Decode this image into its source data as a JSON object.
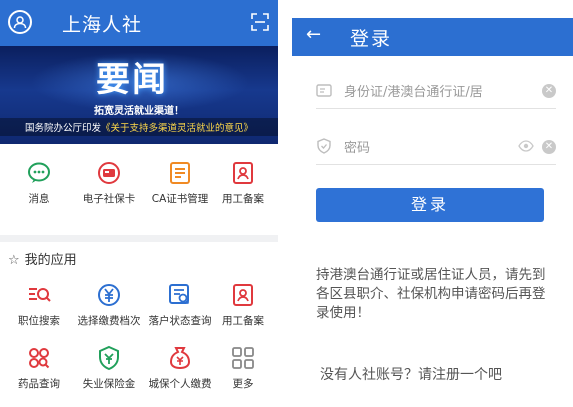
{
  "left": {
    "app_title": "上海人社",
    "banner": {
      "headline": "要闻",
      "sub1": "拓宽灵活就业渠道！",
      "sub2_prefix": "国务院办公厅印发",
      "sub2_highlight": "《关于支持多渠道灵活就业的意见》"
    },
    "top_grid": [
      {
        "label": "消息",
        "icon": "message-icon",
        "color": "#21a05b"
      },
      {
        "label": "电子社保卡",
        "icon": "social-security-card-icon",
        "color": "#e0393e"
      },
      {
        "label": "CA证书管理",
        "icon": "ca-certificate-icon",
        "color": "#f08a24"
      },
      {
        "label": "用工备案",
        "icon": "employment-record-icon",
        "color": "#e0393e"
      }
    ],
    "my_apps_title": "我的应用",
    "apps": [
      {
        "label": "职位搜索",
        "icon": "job-search-icon",
        "color": "#e0393e"
      },
      {
        "label": "选择缴费档次",
        "icon": "payment-level-icon",
        "color": "#2c6fd1"
      },
      {
        "label": "落户状态查询",
        "icon": "settlement-status-icon",
        "color": "#2c6fd1"
      },
      {
        "label": "用工备案",
        "icon": "employment-record-icon",
        "color": "#e0393e"
      },
      {
        "label": "药品查询",
        "icon": "drug-query-icon",
        "color": "#e0393e"
      },
      {
        "label": "失业保险金",
        "icon": "unemployment-insurance-icon",
        "color": "#21a05b"
      },
      {
        "label": "城保个人缴费",
        "icon": "personal-payment-icon",
        "color": "#e0393e"
      },
      {
        "label": "更多",
        "icon": "more-apps-icon",
        "color": "#888888"
      }
    ]
  },
  "right": {
    "title": "登录",
    "id_placeholder": "身份证/港澳台通行证/居",
    "password_placeholder": "密码",
    "login_label": "登录",
    "notice": "持港澳台通行证或居住证人员，请先到各区县职介、社保机构申请密码后再登录使用！",
    "register_text": "没有人社账号？请注册一个吧"
  },
  "colors": {
    "header_blue": "#2c6fd1",
    "button_blue": "#2f72d6"
  }
}
